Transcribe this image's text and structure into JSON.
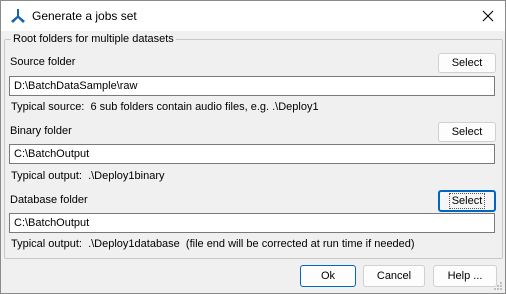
{
  "window": {
    "title": "Generate a jobs set"
  },
  "group": {
    "title": "Root folders for multiple datasets"
  },
  "source": {
    "label": "Source folder",
    "value": "D:\\BatchDataSample\\raw",
    "hint_label": "Typical source:",
    "hint_text": "6 sub folders contain audio files, e.g. .\\Deploy1",
    "select_label": "Select"
  },
  "binary": {
    "label": "Binary folder",
    "value": "C:\\BatchOutput",
    "hint_label": "Typical output:",
    "hint_text": ".\\Deploy1binary",
    "select_label": "Select"
  },
  "database": {
    "label": "Database folder",
    "value": "C:\\BatchOutput",
    "hint_label": "Typical output:",
    "hint_text": ".\\Deploy1database  (file end will be corrected at run time if needed)",
    "select_label": "Select"
  },
  "footer": {
    "ok_label": "Ok",
    "cancel_label": "Cancel",
    "help_label": "Help ..."
  },
  "colors": {
    "accent": "#0067c0",
    "app_icon": "#1a62b0"
  },
  "icons": {
    "app": "app-logo-icon",
    "close": "close-icon",
    "grip": "resize-grip-icon"
  }
}
